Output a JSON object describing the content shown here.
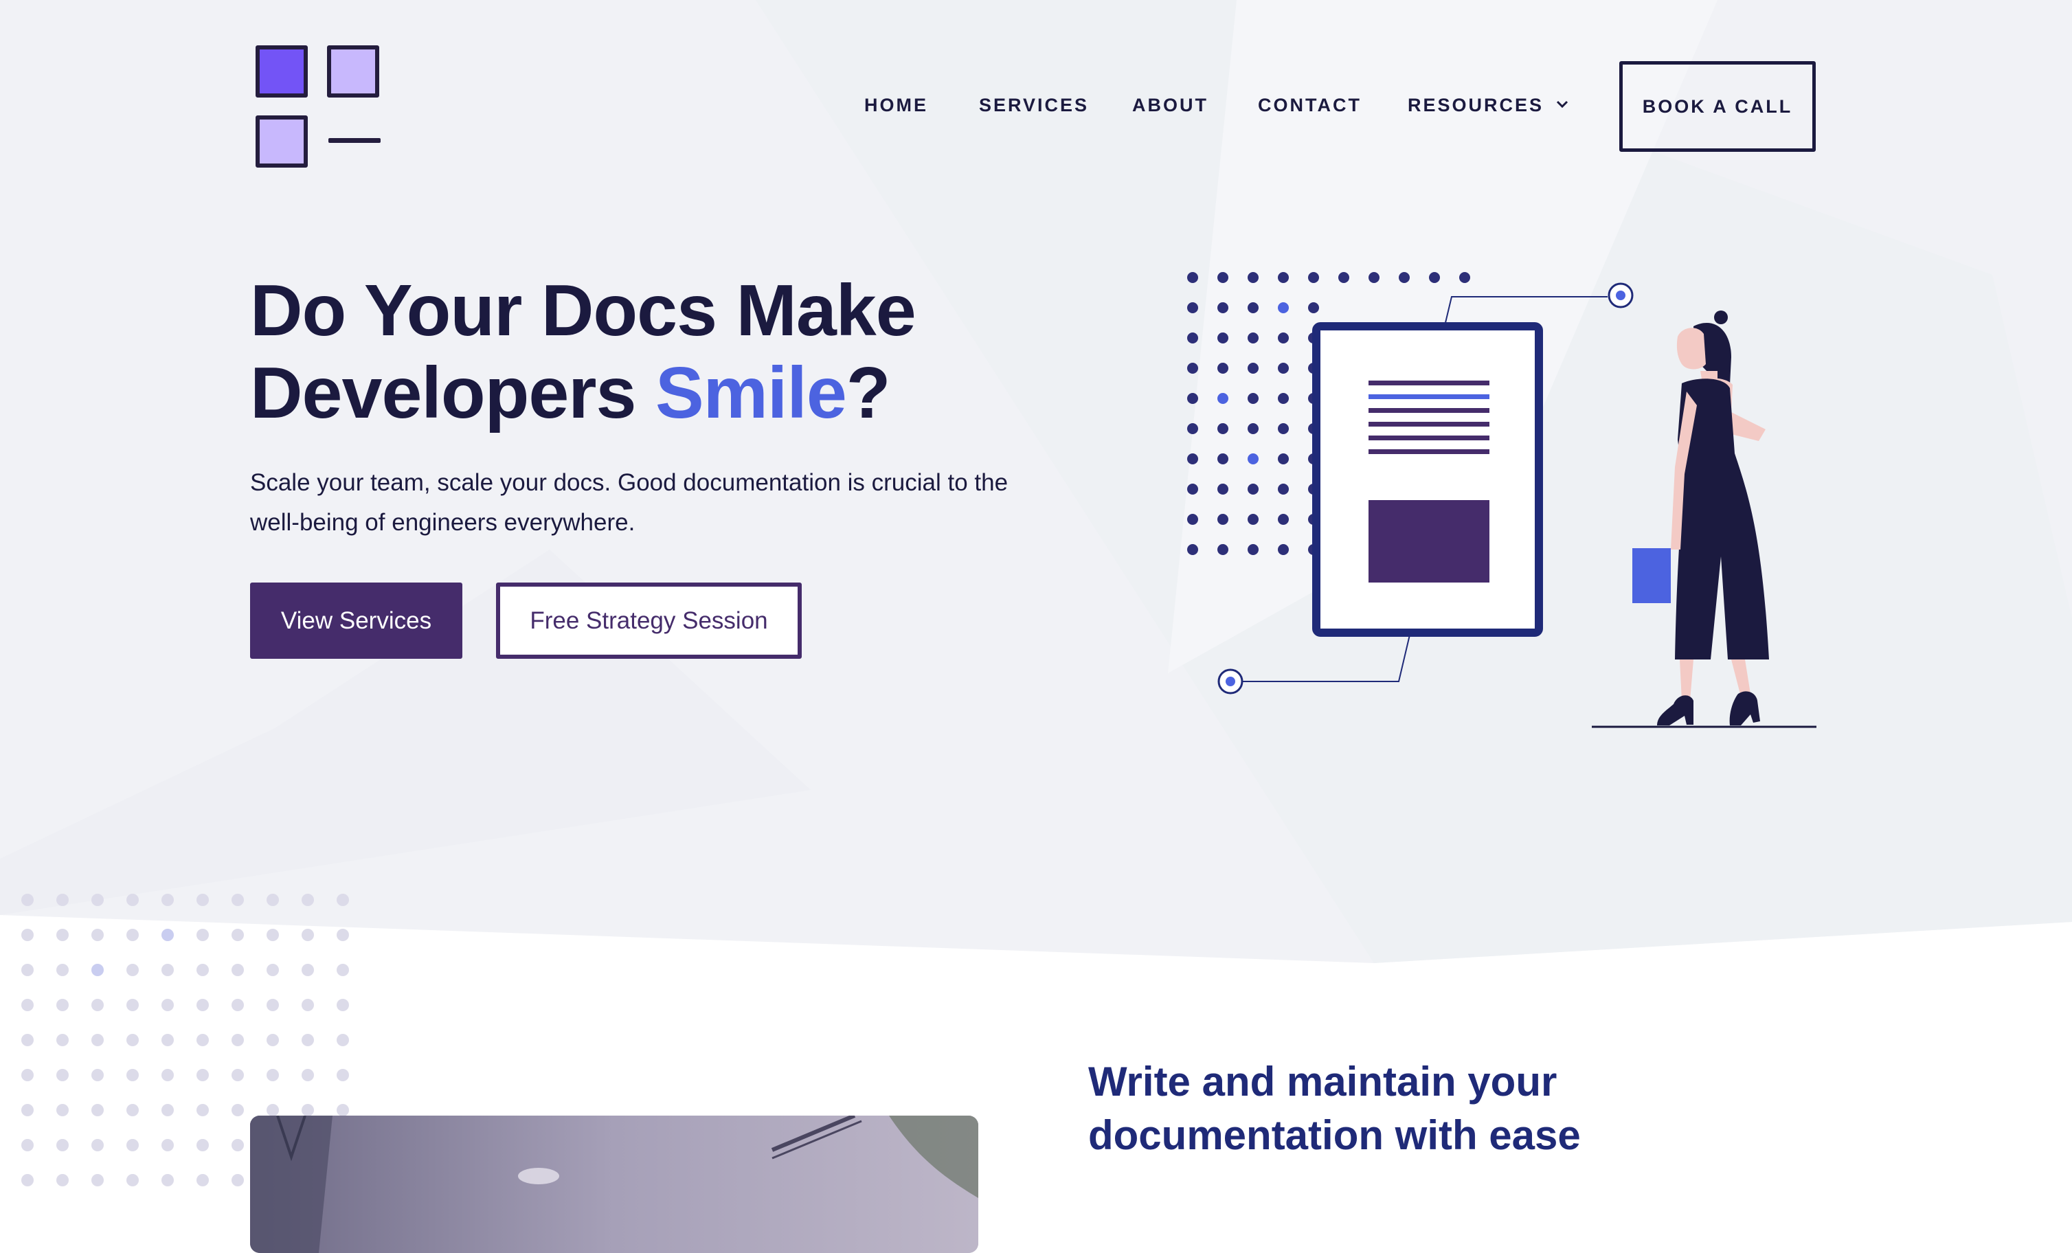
{
  "brand": {
    "logo_icon": "grid-squares-logo",
    "colors": {
      "primary": "#452c6b",
      "accent": "#4c63e0",
      "text": "#1b1a3f",
      "logo_fill_dark": "#7354f6",
      "logo_fill_light": "#c8b8fd"
    }
  },
  "nav": {
    "items": [
      {
        "label": "HOME"
      },
      {
        "label": "SERVICES"
      },
      {
        "label": "ABOUT"
      },
      {
        "label": "CONTACT"
      },
      {
        "label": "RESOURCES",
        "icon": "chevron-down-icon"
      }
    ],
    "cta_label": "BOOK A CALL"
  },
  "hero": {
    "title_line1": "Do Your Docs Make",
    "title_line2_prefix": "Developers ",
    "title_accent": "Smile",
    "title_suffix": "?",
    "subtitle": "Scale your team, scale your docs. Good documentation is crucial to the well-being of engineers everywhere.",
    "primary_button": "View Services",
    "secondary_button": "Free Strategy Session",
    "illustration": "woman-with-document-illustration"
  },
  "section2": {
    "heading_line1": "Write and maintain your",
    "heading_line2": "documentation with ease",
    "image": "office-interior-photo"
  }
}
